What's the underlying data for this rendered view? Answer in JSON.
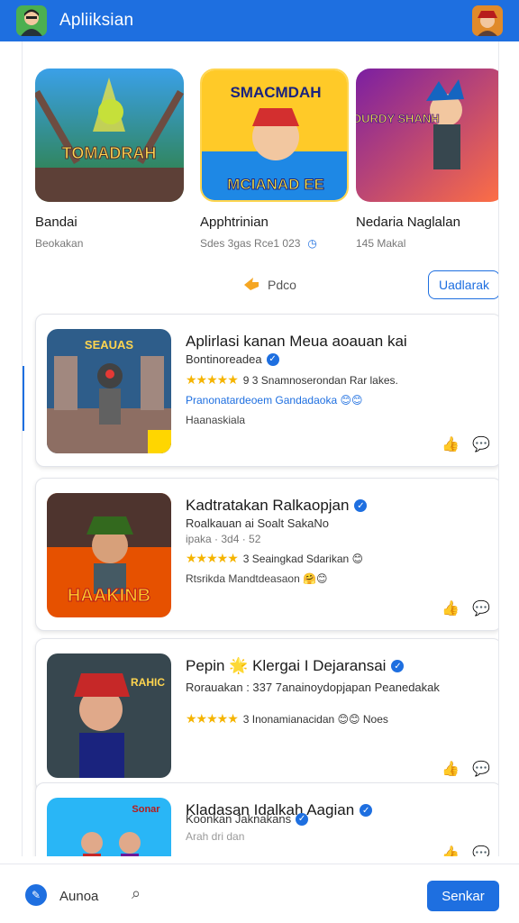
{
  "app": {
    "title": "Apliiksian"
  },
  "featured": [
    {
      "title": "Bandai",
      "meta": "Beokakan",
      "art": "TOMADRAH"
    },
    {
      "title": "Apphtrinian",
      "meta": "Sdes 3gas Rce1 023",
      "art": "SMACMDAH",
      "art2": "MCIANAD EE"
    },
    {
      "title": "Nedaria Naglalan",
      "meta": "145 Makal",
      "art": "SOURDY SHANH"
    }
  ],
  "promo": {
    "label": "Pdco",
    "button": "Uadlarak"
  },
  "cards": [
    {
      "title": "Aplirlasi kanan Meua aoauan kai",
      "subtitle": "Bontinoreadea",
      "rating_text": "9 3 Snamnoserondan Rar lakes.",
      "tag": "Pranonatardeoem Gandadaoka 😊😊",
      "footer": "Haanaskiala",
      "art": "SEAUAS"
    },
    {
      "title": "Kadtratakan Ralkaopjan",
      "subtitle": "Roalkauan ai Soalt SakaNo",
      "subtitle2": "ipaka · 3d4 · 52",
      "rating_text": "3 Seaingkad Sdarikan 😊",
      "footer": "Rtsrikda Mandtdeasaon 🤗😊",
      "art": "HAAKINB"
    },
    {
      "title": "Pepin 🌟 Klergai I Dejaransai",
      "subtitle": "Rorauakan : 337 7anainoydopjapan Peanedakak",
      "rating_text": "3 Inonamianacidan 😊😊 Noes",
      "footer": "",
      "art": "RAHIC"
    },
    {
      "title": "Kladasan Idalkah Aagian",
      "subtitle": "Koonkan Jaknakans",
      "subtitle2": "Arah dri dan",
      "art": "Sonar"
    }
  ],
  "bottom": {
    "label": "Aunoa",
    "button": "Senkar"
  },
  "colors": {
    "primary": "#1e6fe0",
    "star": "#f5b400"
  }
}
